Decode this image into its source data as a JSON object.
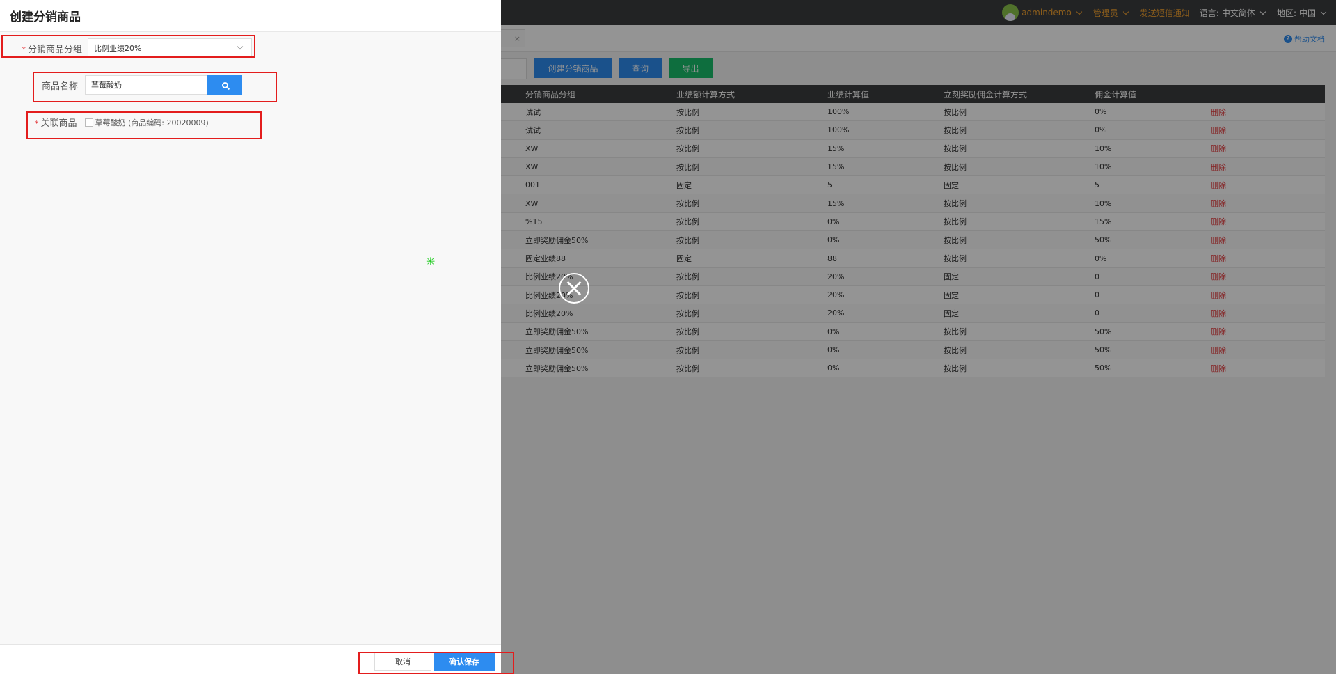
{
  "topbar": {
    "user": "admindemo",
    "role": "管理员",
    "sms_notice": "发送短信通知",
    "language_label": "语言:",
    "language_value": "中文简体",
    "region_label": "地区:",
    "region_value": "中国"
  },
  "help_link": "帮助文档",
  "help_icon": "?",
  "toolbar": {
    "create_button": "创建分销商品",
    "query_button": "查询",
    "export_button": "导出"
  },
  "table": {
    "columns": [
      "分销商品分组",
      "业绩额计算方式",
      "业绩计算值",
      "立刻奖励佣金计算方式",
      "佣金计算值"
    ],
    "rows": [
      {
        "group": "试试",
        "perf_method": "按比例",
        "perf_value": "100%",
        "comm_method": "按比例",
        "comm_value": "0%",
        "action": "删除"
      },
      {
        "group": "试试",
        "perf_method": "按比例",
        "perf_value": "100%",
        "comm_method": "按比例",
        "comm_value": "0%",
        "action": "删除"
      },
      {
        "group": "XW",
        "perf_method": "按比例",
        "perf_value": "15%",
        "comm_method": "按比例",
        "comm_value": "10%",
        "action": "删除"
      },
      {
        "group": "XW",
        "perf_method": "按比例",
        "perf_value": "15%",
        "comm_method": "按比例",
        "comm_value": "10%",
        "action": "删除"
      },
      {
        "group": "001",
        "perf_method": "固定",
        "perf_value": "5",
        "comm_method": "固定",
        "comm_value": "5",
        "action": "删除"
      },
      {
        "group": "XW",
        "perf_method": "按比例",
        "perf_value": "15%",
        "comm_method": "按比例",
        "comm_value": "10%",
        "action": "删除"
      },
      {
        "group": "%15",
        "perf_method": "按比例",
        "perf_value": "0%",
        "comm_method": "按比例",
        "comm_value": "15%",
        "action": "删除"
      },
      {
        "group": "立即奖励佣金50%",
        "perf_method": "按比例",
        "perf_value": "0%",
        "comm_method": "按比例",
        "comm_value": "50%",
        "action": "删除"
      },
      {
        "group": "固定业绩88",
        "perf_method": "固定",
        "perf_value": "88",
        "comm_method": "按比例",
        "comm_value": "0%",
        "action": "删除"
      },
      {
        "group": "比例业绩20%",
        "perf_method": "按比例",
        "perf_value": "20%",
        "comm_method": "固定",
        "comm_value": "0",
        "action": "删除"
      },
      {
        "group": "比例业绩20%",
        "perf_method": "按比例",
        "perf_value": "20%",
        "comm_method": "固定",
        "comm_value": "0",
        "action": "删除"
      },
      {
        "group": "比例业绩20%",
        "perf_method": "按比例",
        "perf_value": "20%",
        "comm_method": "固定",
        "comm_value": "0",
        "action": "删除"
      },
      {
        "group": "立即奖励佣金50%",
        "perf_method": "按比例",
        "perf_value": "0%",
        "comm_method": "按比例",
        "comm_value": "50%",
        "action": "删除"
      },
      {
        "group": "立即奖励佣金50%",
        "perf_method": "按比例",
        "perf_value": "0%",
        "comm_method": "按比例",
        "comm_value": "50%",
        "action": "删除"
      },
      {
        "group": "立即奖励佣金50%",
        "perf_method": "按比例",
        "perf_value": "0%",
        "comm_method": "按比例",
        "comm_value": "50%",
        "action": "删除"
      }
    ]
  },
  "drawer": {
    "title": "创建分销商品",
    "required_mark": "*",
    "group_label": "分销商品分组",
    "group_value": "比例业绩20%",
    "name_label": "商品名称",
    "name_value": "草莓酸奶",
    "related_label": "关联商品",
    "related_product": "草莓酸奶 (商品编码: 20020009)",
    "cancel_button": "取消",
    "save_button": "确认保存"
  },
  "colors": {
    "primary": "#2d8cf0",
    "export": "#19be6b",
    "danger": "#e4393c",
    "highlight": "#e31d1d",
    "header_dark": "#3c3d3f"
  },
  "icons": [
    "avatar",
    "chevron-down-icon",
    "help-icon",
    "search-icon",
    "close-icon",
    "checkbox"
  ]
}
